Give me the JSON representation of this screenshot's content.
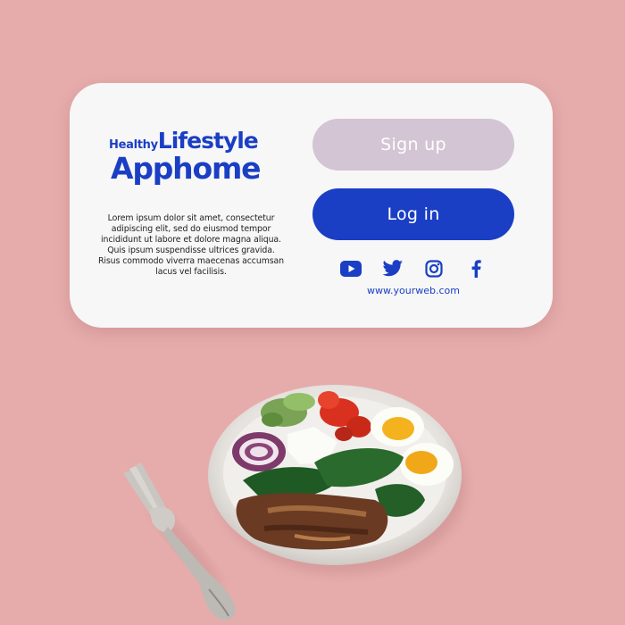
{
  "brand": {
    "small": "Healthy",
    "mid": "Lifestyle",
    "big": "Apphome"
  },
  "description": "Lorem ipsum dolor sit amet, consectetur adipiscing elit, sed do eiusmod tempor incididunt ut labore et dolore magna aliqua. Quis ipsum suspendisse ultrices gravida. Risus commodo viverra maecenas accumsan lacus vel facilisis.",
  "buttons": {
    "signup": "Sign up",
    "login": "Log in"
  },
  "socials": [
    {
      "icon": "youtube-icon"
    },
    {
      "icon": "twitter-icon"
    },
    {
      "icon": "instagram-icon"
    },
    {
      "icon": "facebook-icon"
    }
  ],
  "website": "www.yourweb.com",
  "colors": {
    "background": "#e6acab",
    "card": "#f7f7f7",
    "brand_blue": "#1a3fc4",
    "signup_button": "#d3c5d4"
  }
}
